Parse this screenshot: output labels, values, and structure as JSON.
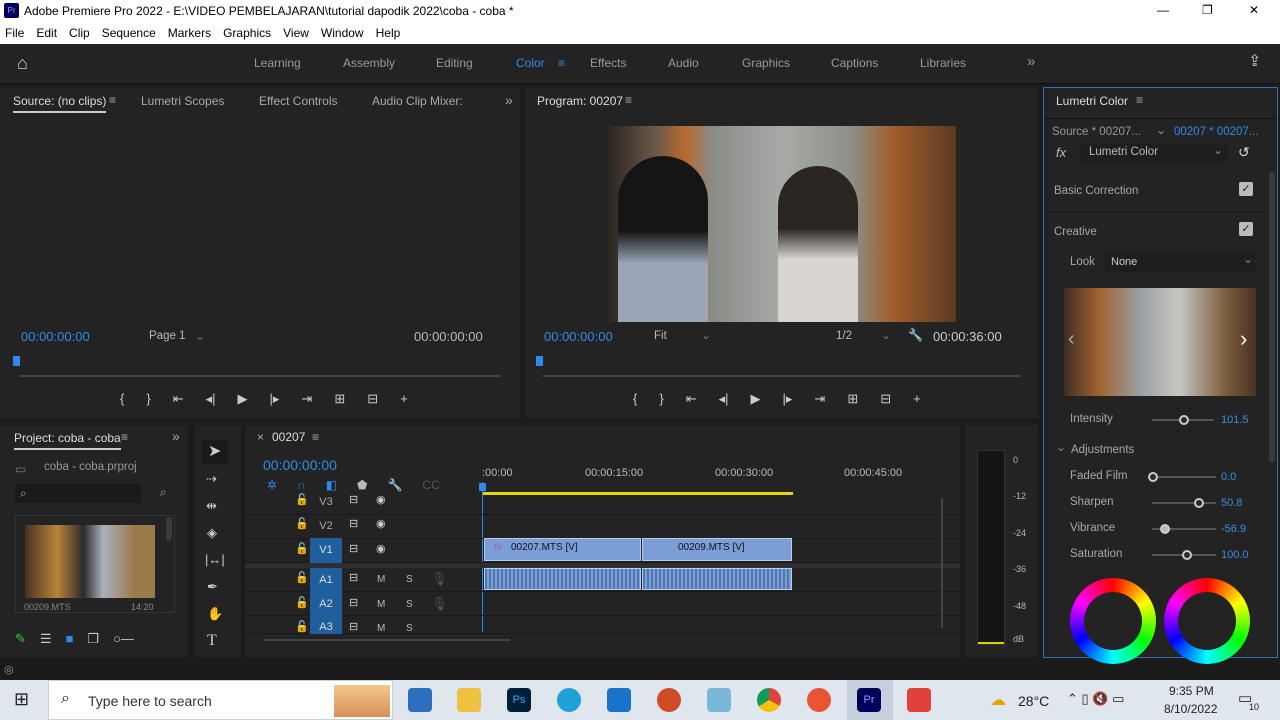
{
  "window": {
    "title": "Adobe Premiere Pro 2022 - E:\\VIDEO PEMBELAJARAN\\tutorial dapodik 2022\\coba - coba *",
    "minimize": "—",
    "restore": "❐",
    "close": "✕"
  },
  "menu": [
    "File",
    "Edit",
    "Clip",
    "Sequence",
    "Markers",
    "Graphics",
    "View",
    "Window",
    "Help"
  ],
  "workspaces": {
    "items": [
      "Learning",
      "Assembly",
      "Editing",
      "Color",
      "Effects",
      "Audio",
      "Graphics",
      "Captions",
      "Libraries"
    ],
    "active": "Color",
    "more": "»"
  },
  "source": {
    "tabs": [
      "Source: (no clips)",
      "Lumetri Scopes",
      "Effect Controls",
      "Audio Clip Mixer:"
    ],
    "timecode_left": "00:00:00:00",
    "page": "Page 1",
    "timecode_right": "00:00:00:00"
  },
  "program": {
    "title": "Program: 00207",
    "timecode": "00:00:00:00",
    "fit": "Fit",
    "resolution": "1/2",
    "duration": "00:00:36:00"
  },
  "project": {
    "title": "Project: coba - coba",
    "file": "coba - coba.prproj",
    "clip_name": "00209.MTS",
    "clip_duration": "14:20"
  },
  "timeline": {
    "sequence": "00207",
    "timecode": "00:00:00:00",
    "ruler": [
      ":00:00",
      "00:00:15:00",
      "00:00:30:00",
      "00:00:45:00"
    ],
    "video_tracks": [
      "V3",
      "V2",
      "V1"
    ],
    "audio_tracks": [
      "A1",
      "A2",
      "A3"
    ],
    "mute": "M",
    "solo": "S",
    "clips": [
      "00207.MTS [V]",
      "00209.MTS [V]"
    ],
    "fx_badge": "fx"
  },
  "meters": [
    "0",
    "-12",
    "-24",
    "-36",
    "-48",
    "dB"
  ],
  "lumetri": {
    "title": "Lumetri Color",
    "source": "Source * 00207...",
    "target": "00207 * 00207...",
    "effect": "Lumetri Color",
    "fx": "fx",
    "sections": [
      "Basic Correction",
      "Creative"
    ],
    "look_label": "Look",
    "look_value": "None",
    "intensity": {
      "label": "Intensity",
      "value": "101.5"
    },
    "adjustments": "Adjustments",
    "params": [
      {
        "label": "Faded Film",
        "value": "0.0"
      },
      {
        "label": "Sharpen",
        "value": "50.8"
      },
      {
        "label": "Vibrance",
        "value": "-56.9"
      },
      {
        "label": "Saturation",
        "value": "100.0"
      }
    ]
  },
  "taskbar": {
    "search": "Type here to search",
    "temp": "28°C",
    "time": "9:35 PM",
    "date": "8/10/2022",
    "notif": "10"
  },
  "colors": {
    "accent": "#2d8ceb",
    "panel": "#232323",
    "clip": "#7b9ed6"
  }
}
